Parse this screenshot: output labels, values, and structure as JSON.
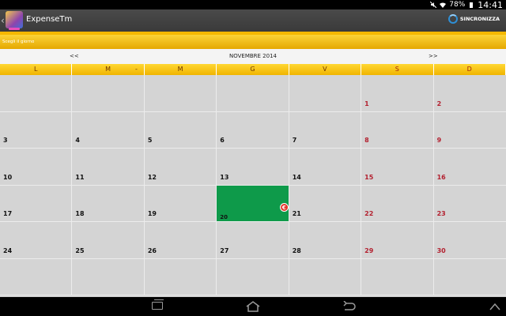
{
  "status_bar": {
    "battery": "78%",
    "time": "14:41"
  },
  "action_bar": {
    "title": "ExpenseTm",
    "sync_label": "SINCRONIZZA"
  },
  "hint": "Scegli il giorno",
  "calendar": {
    "prev_label": "<<",
    "month_label": "NOVEMBRE 2014",
    "next_label": ">>",
    "weekdays": [
      "L",
      "M",
      "M",
      "G",
      "V",
      "S",
      "D"
    ],
    "header_dash": "-",
    "today_marker_icon": "euro-icon",
    "today_marker_glyph": "€",
    "cells": [
      "",
      "",
      "",
      "",
      "",
      "1",
      "2",
      "3",
      "4",
      "5",
      "6",
      "7",
      "8",
      "9",
      "10",
      "11",
      "12",
      "13",
      "14",
      "15",
      "16",
      "17",
      "18",
      "19",
      "20",
      "21",
      "22",
      "23",
      "24",
      "25",
      "26",
      "27",
      "28",
      "29",
      "30",
      "",
      "",
      "",
      "",
      "",
      "",
      ""
    ]
  },
  "colors": {
    "today": "#0e9a4a",
    "weekend": "#b3202f",
    "header": "#f5b800"
  }
}
